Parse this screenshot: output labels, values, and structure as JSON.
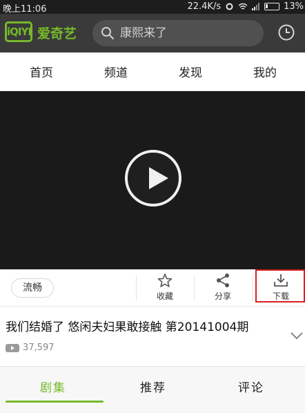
{
  "status_bar": {
    "time": "晚上11:06",
    "network_speed": "22.4K/s",
    "battery": "13%"
  },
  "header": {
    "logo_mark": "iQIYI",
    "logo_text": "爱奇艺",
    "search": {
      "placeholder": "康熙来了"
    }
  },
  "nav": {
    "items": [
      {
        "label": "首页"
      },
      {
        "label": "频道"
      },
      {
        "label": "发现"
      },
      {
        "label": "我的"
      }
    ]
  },
  "actions": {
    "quality_label": "流畅",
    "favorite_label": "收藏",
    "share_label": "分享",
    "download_label": "下载",
    "highlight_color": "#d42020"
  },
  "video": {
    "title": "我们结婚了 悠闲夫妇果敢接触 第20141004期",
    "view_count": "37,597"
  },
  "tabs": [
    {
      "label": "剧集"
    },
    {
      "label": "推荐"
    },
    {
      "label": "评论"
    }
  ],
  "colors": {
    "accent": "#76b82a",
    "header_bg": "#3a3a3a"
  }
}
